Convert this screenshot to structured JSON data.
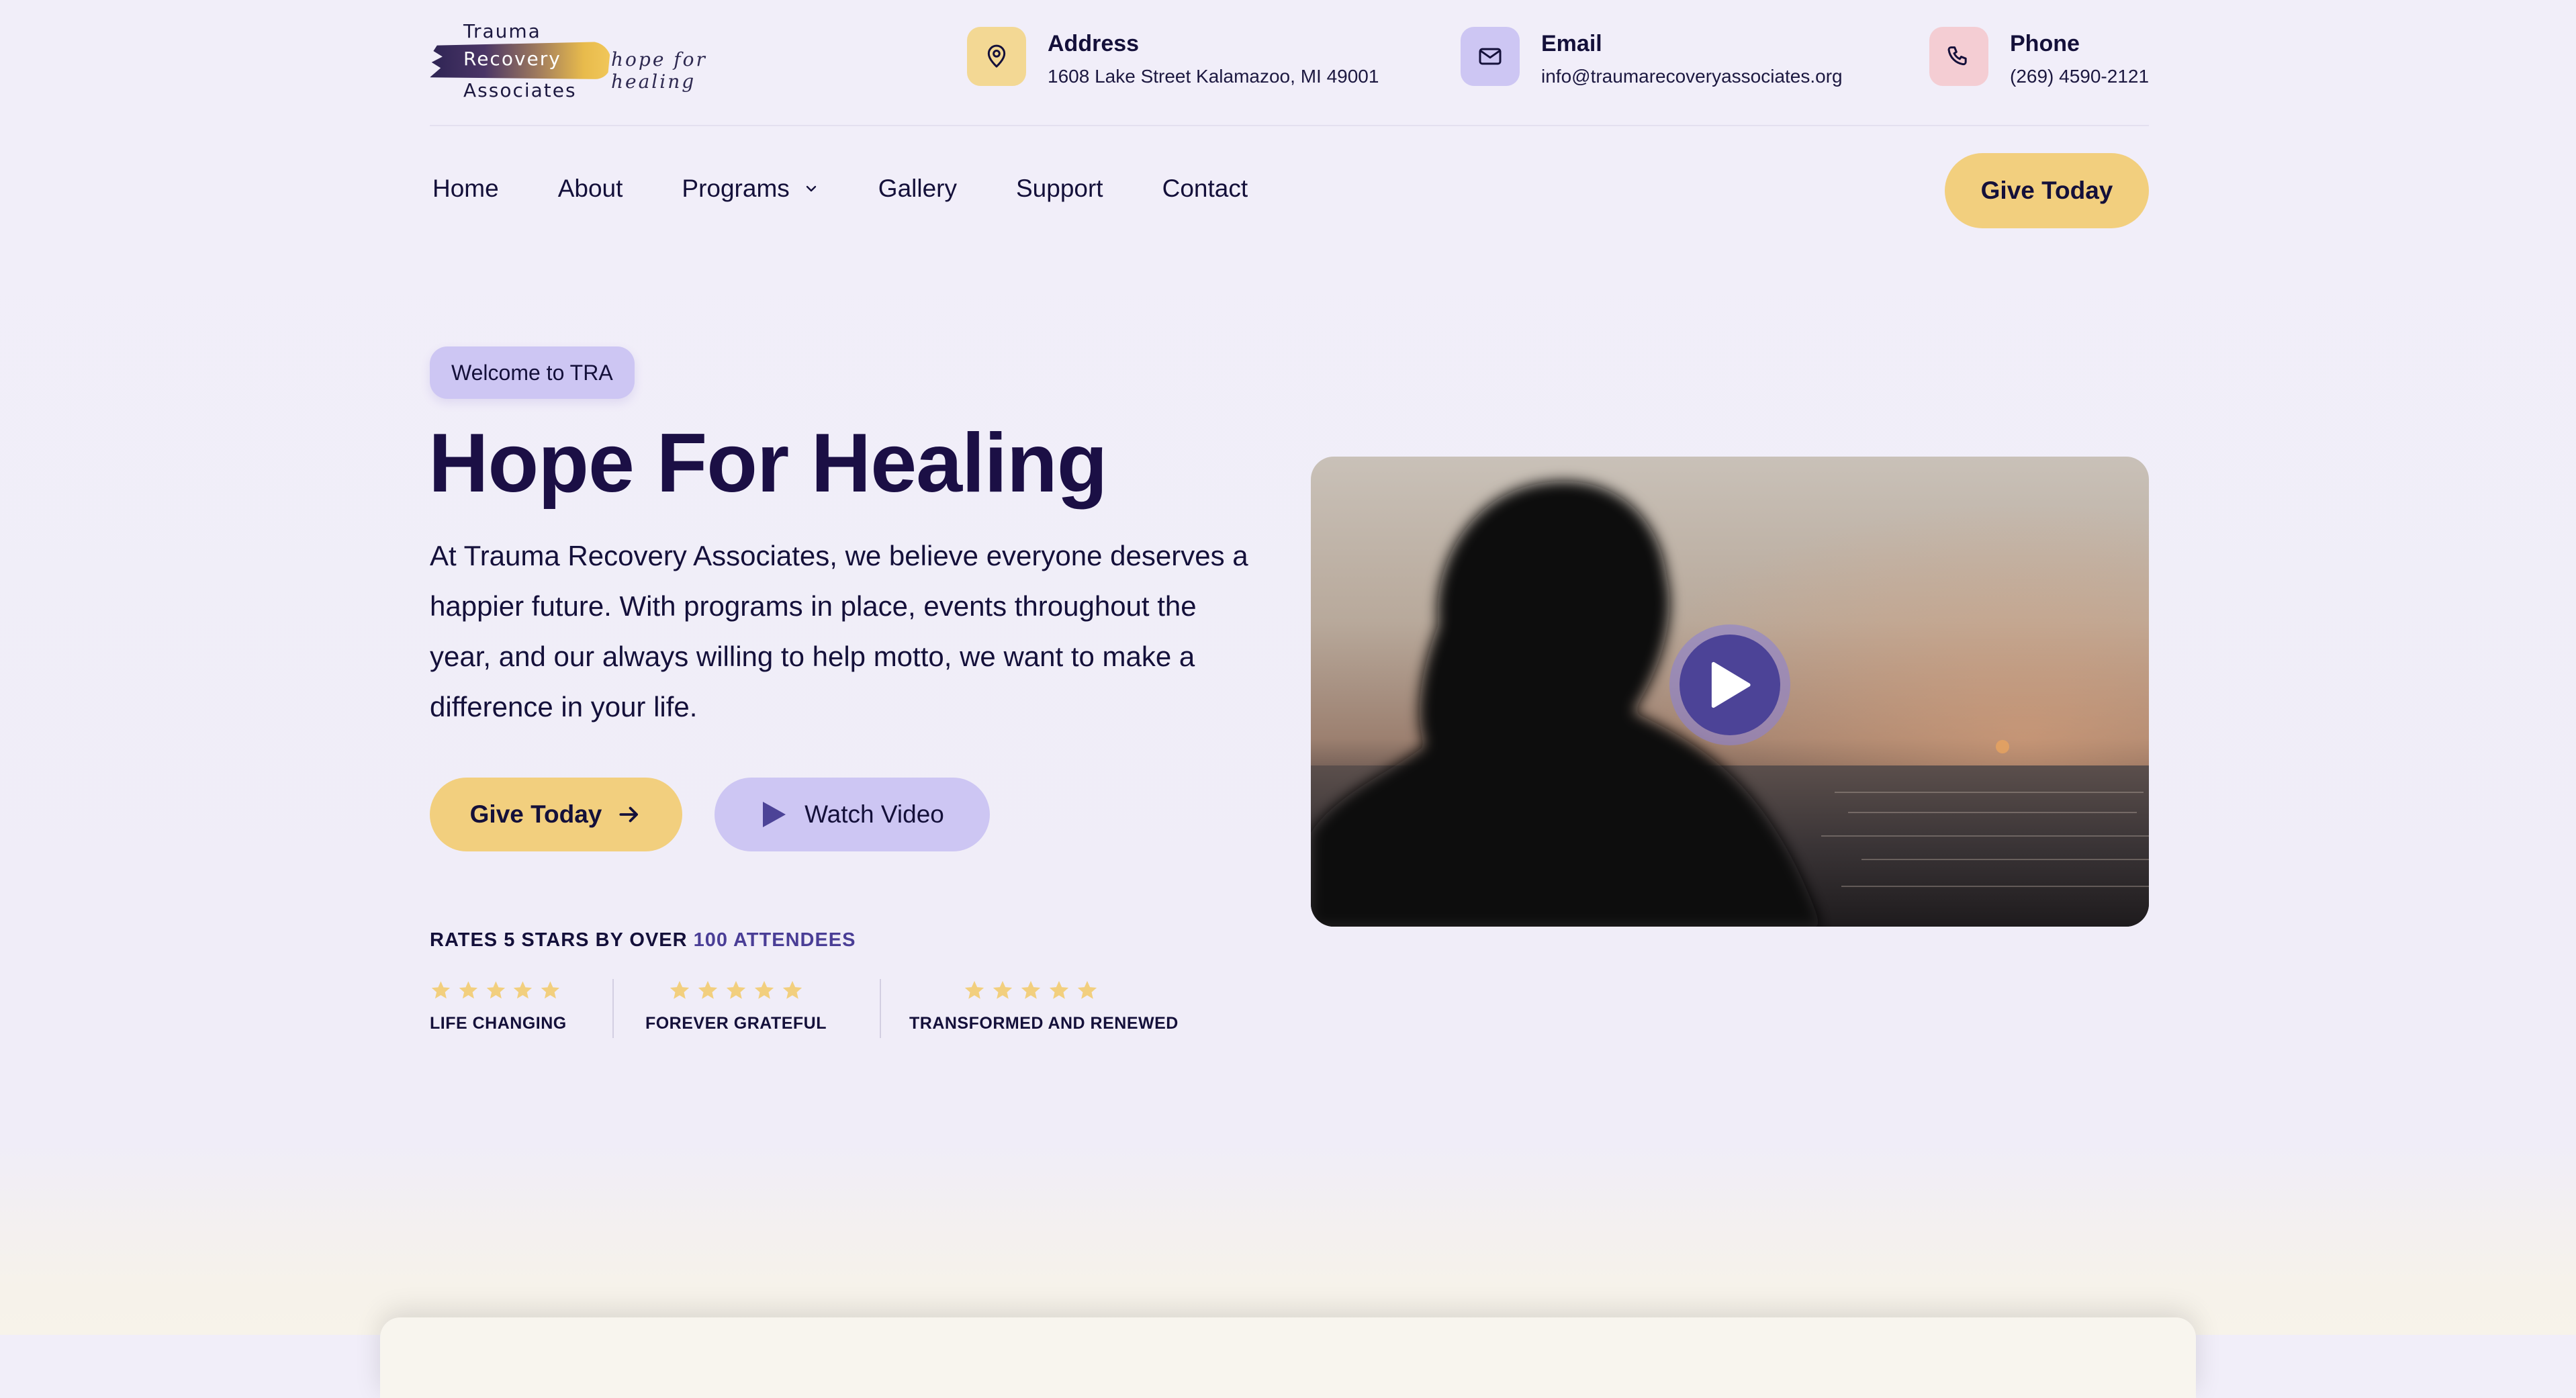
{
  "brand": {
    "line1": "Trauma",
    "line2": "Recovery",
    "line3": "Associates",
    "tagline": "hope  for  healing"
  },
  "contacts": {
    "address": {
      "label": "Address",
      "value": "1608 Lake Street Kalamazoo, MI 49001",
      "icon": "map-pin-icon"
    },
    "email": {
      "label": "Email",
      "value": "info@traumarecoveryassociates.org",
      "icon": "mail-icon"
    },
    "phone": {
      "label": "Phone",
      "value": "(269) 4590-2121",
      "icon": "phone-icon"
    }
  },
  "nav": {
    "items": [
      {
        "label": "Home"
      },
      {
        "label": "About"
      },
      {
        "label": "Programs",
        "has_dropdown": true
      },
      {
        "label": "Gallery"
      },
      {
        "label": "Support"
      },
      {
        "label": "Contact"
      }
    ],
    "cta_label": "Give Today"
  },
  "hero": {
    "badge": "Welcome to TRA",
    "title": "Hope For Healing",
    "text": "At Trauma Recovery Associates, we believe everyone deserves a happier future. With programs in place, events throughout the year, and our always willing to help motto, we want to make a difference in your life.",
    "give_label": "Give Today",
    "watch_label": "Watch Video",
    "rates_prefix": "RATES 5 STARS BY OVER ",
    "rates_highlight": "100 ATTENDEES",
    "ratings": [
      {
        "label": "LIFE CHANGING",
        "stars": 5
      },
      {
        "label": "FOREVER GRATEFUL",
        "stars": 5
      },
      {
        "label": "TRANSFORMED AND RENEWED",
        "stars": 5
      }
    ]
  },
  "colors": {
    "background": "#f1eef9",
    "primary_dark": "#1b0f45",
    "accent_yellow": "#f2cf7e",
    "accent_lavender": "#cdc6f3",
    "accent_pink": "#f4cdd3",
    "highlight_purple": "#4a3e96",
    "star": "#f2cf7e"
  }
}
